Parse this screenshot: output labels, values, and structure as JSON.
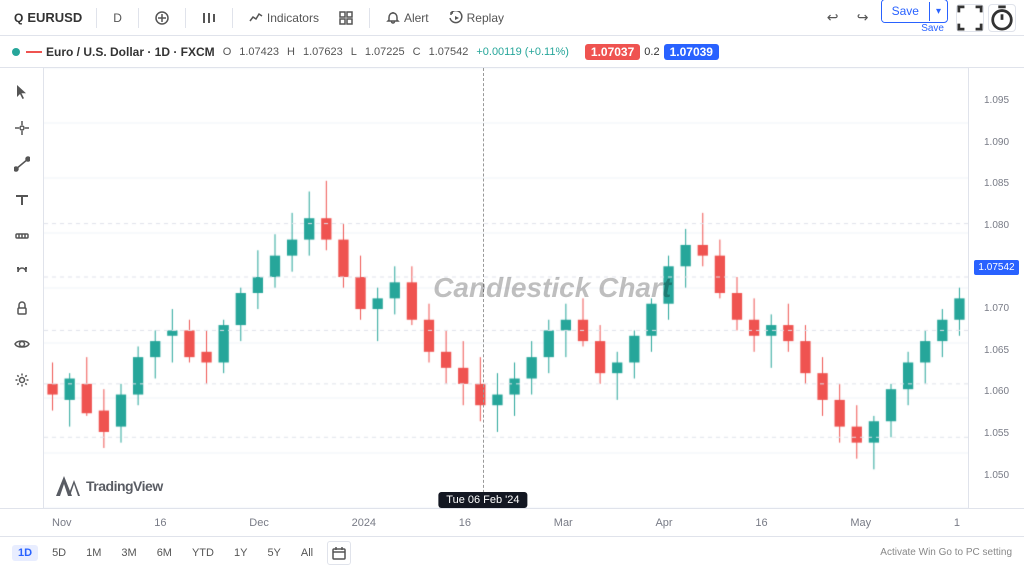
{
  "toolbar": {
    "symbol": "EURUSD",
    "timeframe": "D",
    "compare_label": "Compare",
    "indicators_label": "Indicators",
    "layout_label": "",
    "alert_label": "Alert",
    "replay_label": "Replay",
    "save_label": "Save",
    "save_sub": "Save"
  },
  "chart_header": {
    "symbol_full": "Euro / U.S. Dollar · 1D · FXCM",
    "open_label": "O",
    "open_val": "1.07423",
    "high_label": "H",
    "high_val": "1.07623",
    "low_label": "L",
    "low_val": "1.07225",
    "close_label": "C",
    "close_val": "1.07542",
    "change": "+0.00119 (+0.11%)",
    "price1": "1.07037",
    "price2": "0.2",
    "price3": "1.07039"
  },
  "candlestick_label": "Candlestick Chart",
  "date_axis": {
    "labels": [
      "Nov",
      "16",
      "Dec",
      "2024",
      "16",
      "Mar",
      "Apr",
      "16",
      "May",
      "1"
    ],
    "selected_date": "Tue 06 Feb '24"
  },
  "timeframes": [
    "1D",
    "5D",
    "1M",
    "3M",
    "6M",
    "YTD",
    "1Y",
    "5Y",
    "All"
  ],
  "active_timeframe": "1D",
  "tradingview": {
    "logo_text": "TradingView"
  },
  "activate_windows": "Activate Win\nGo to PC setting",
  "price_levels": [
    "1.09",
    "1.08",
    "1.07",
    "1.06",
    "1.05"
  ],
  "icons": {
    "search": "🔍",
    "plus": "+",
    "bartype": "📊",
    "indicators": "📈",
    "layout": "▦",
    "alert": "🔔",
    "replay": "▶",
    "undo": "↩",
    "redo": "↪",
    "fullscreen": "⛶",
    "timer": "⏱",
    "crosshair": "✛",
    "cursor": "↖",
    "ruler": "📏",
    "magnet": "🧲",
    "lock": "🔒",
    "eye": "👁",
    "settings": "⚙",
    "calendar": "📅"
  }
}
